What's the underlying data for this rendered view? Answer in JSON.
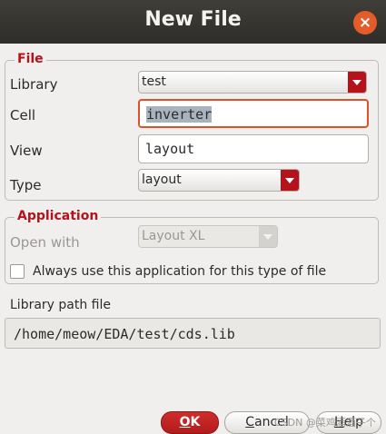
{
  "window": {
    "title": "New File",
    "close_glyph": "×"
  },
  "file_group": {
    "legend": "File",
    "library": {
      "label": "Library",
      "value": "test"
    },
    "cell": {
      "label": "Cell",
      "value": "inverter"
    },
    "view": {
      "label": "View",
      "value": "layout"
    },
    "type": {
      "label": "Type",
      "value": "layout"
    }
  },
  "application_group": {
    "legend": "Application",
    "open_with": {
      "label": "Open with",
      "value": "Layout XL",
      "disabled": true
    },
    "always_use": {
      "label": "Always use this application for this type of file",
      "checked": false
    }
  },
  "library_path": {
    "label": "Library path file",
    "value": "/home/meow/EDA/test/cds.lib"
  },
  "buttons": {
    "ok": {
      "mnemonic": "O",
      "rest": "K"
    },
    "cancel": {
      "mnemonic": "C",
      "rest": "ancel"
    },
    "help": {
      "mnemonic": "H",
      "rest": "elp"
    }
  },
  "watermark": "CSDN @菜鸡酒酒子个",
  "colors": {
    "accent": "#b5121b",
    "titlebar": "#333230",
    "close": "#e35c2a",
    "focus": "#e0502a"
  }
}
